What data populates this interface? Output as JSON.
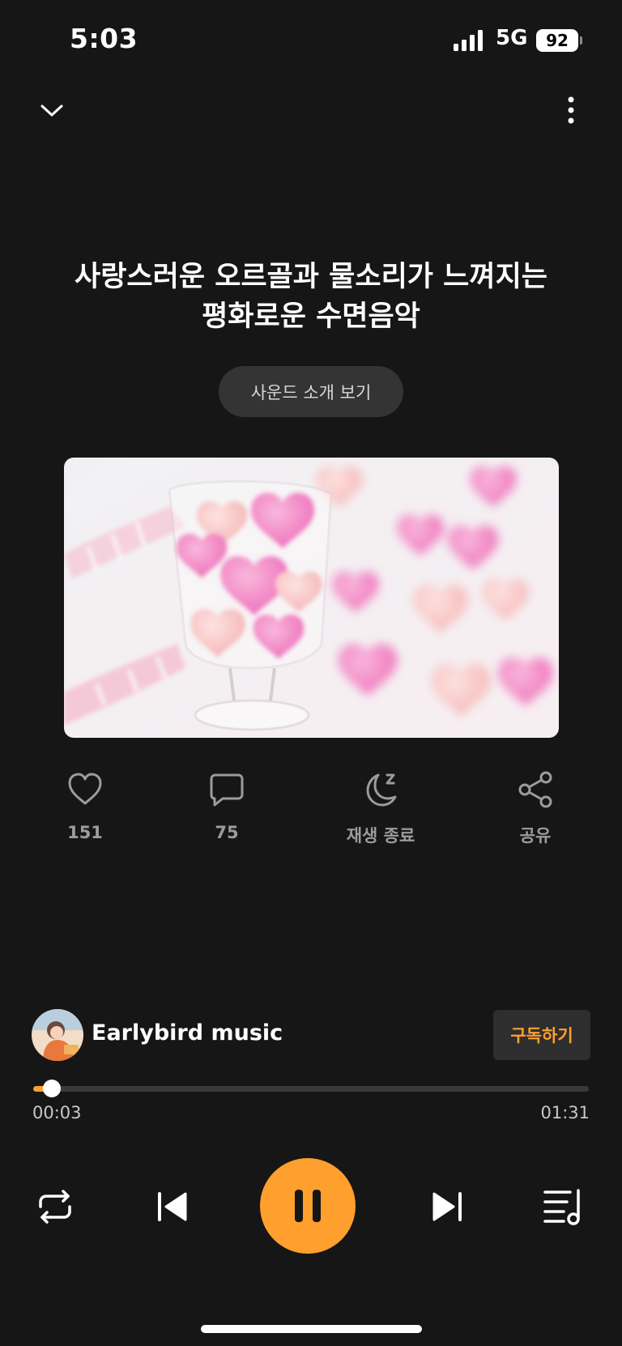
{
  "status_bar": {
    "time": "5:03",
    "network": "5G",
    "battery": "92"
  },
  "nav": {
    "collapse_icon": "chevron-down-icon",
    "more_icon": "more-vertical-icon"
  },
  "track": {
    "title_line1": "사랑스러운 오르골과 물소리가 느껴지는",
    "title_line2": "평화로운 수면음악",
    "intro_button": "사운드 소개 보기"
  },
  "actions": {
    "like_count": "151",
    "comment_count": "75",
    "sleep_timer_label": "재생 종료",
    "share_label": "공유"
  },
  "channel": {
    "name": "Earlybird music",
    "subscribe_label": "구독하기"
  },
  "player": {
    "current_time": "00:03",
    "total_time": "01:31",
    "progress": 0.033
  },
  "colors": {
    "accent": "#ff9f2e",
    "background": "#161616"
  }
}
